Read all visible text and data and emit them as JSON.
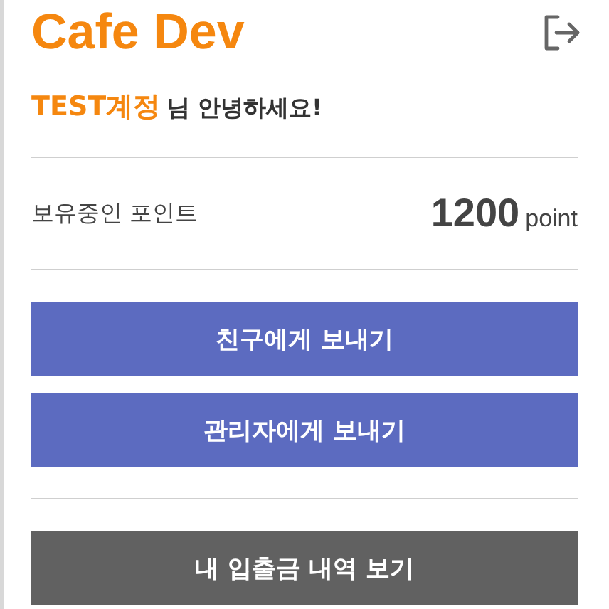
{
  "header": {
    "title": "Cafe Dev"
  },
  "greeting": {
    "user_name": "TEST계정",
    "suffix": "님 안녕하세요!"
  },
  "points": {
    "label": "보유중인 포인트",
    "value": "1200",
    "unit": "point"
  },
  "send_buttons": [
    {
      "label": "친구에게 보내기"
    },
    {
      "label": "관리자에게 보내기"
    }
  ],
  "history_button": {
    "label": "내 입출금 내역 보기"
  }
}
